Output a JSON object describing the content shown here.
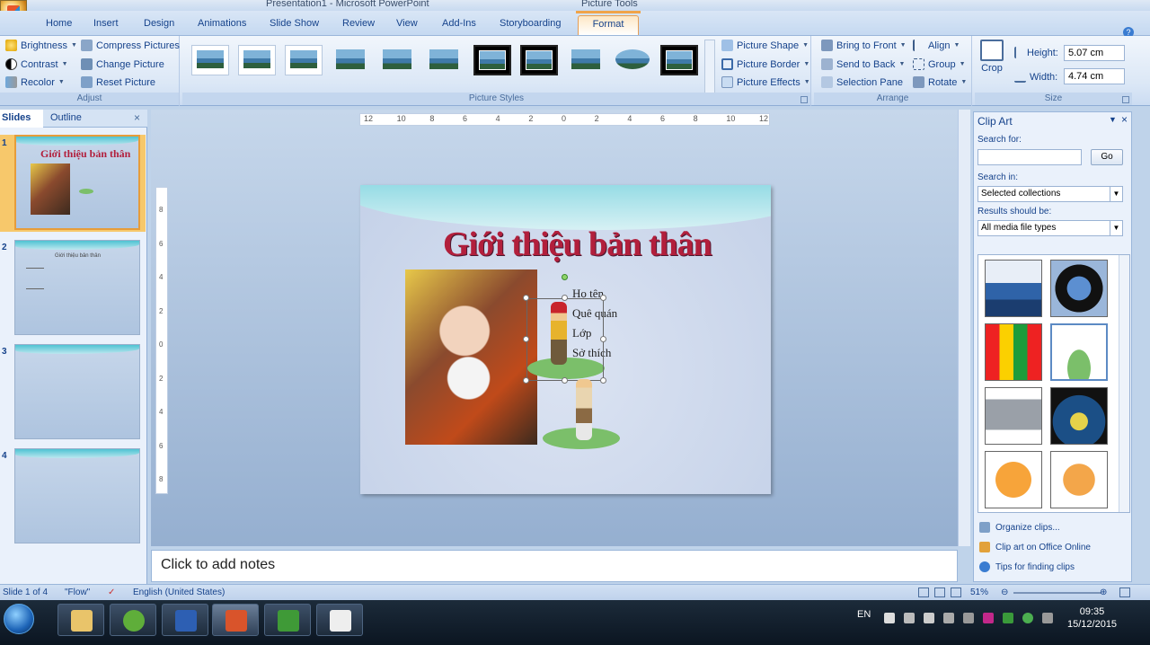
{
  "window": {
    "title": "Presentation1 - Microsoft PowerPoint",
    "context_tab_group": "Picture Tools"
  },
  "tabs": [
    "Home",
    "Insert",
    "Design",
    "Animations",
    "Slide Show",
    "Review",
    "View",
    "Add-Ins",
    "Storyboarding",
    "Format"
  ],
  "active_tab": "Format",
  "ribbon": {
    "adjust": {
      "label": "Adjust",
      "brightness": "Brightness",
      "contrast": "Contrast",
      "recolor": "Recolor",
      "compress": "Compress Pictures",
      "change": "Change Picture",
      "reset": "Reset Picture"
    },
    "styles": {
      "label": "Picture Styles",
      "shape": "Picture Shape",
      "border": "Picture Border",
      "effects": "Picture Effects"
    },
    "arrange": {
      "label": "Arrange",
      "bring_front": "Bring to Front",
      "send_back": "Send to Back",
      "selection_pane": "Selection Pane",
      "align": "Align",
      "group": "Group",
      "rotate": "Rotate"
    },
    "size": {
      "label": "Size",
      "crop": "Crop",
      "height_label": "Height:",
      "height_value": "5.07 cm",
      "width_label": "Width:",
      "width_value": "4.74 cm"
    }
  },
  "left_panel": {
    "tab_slides": "Slides",
    "tab_outline": "Outline",
    "close": "×",
    "slides": [
      {
        "num": "1",
        "title": "Giới thiệu bản thân"
      },
      {
        "num": "2",
        "title": "Giới thiệu bản thân"
      },
      {
        "num": "3"
      },
      {
        "num": "4"
      }
    ]
  },
  "ruler": {
    "h_ticks": [
      "12",
      "10",
      "8",
      "6",
      "4",
      "2",
      "0",
      "2",
      "4",
      "6",
      "8",
      "10",
      "12"
    ],
    "v_ticks": [
      "8",
      "6",
      "4",
      "2",
      "0",
      "2",
      "4",
      "6",
      "8"
    ]
  },
  "slide": {
    "title": "Giới thiệu bản thân",
    "bullets": [
      "Họ tên",
      "Quê quán",
      "Lớp",
      "Sở thích"
    ]
  },
  "notes": {
    "placeholder": "Click to add notes"
  },
  "clip_art": {
    "title": "Clip Art",
    "search_for": "Search for:",
    "go": "Go",
    "search_in": "Search in:",
    "search_in_value": "Selected collections",
    "results_label": "Results should be:",
    "results_value": "All media file types",
    "links": [
      "Organize clips...",
      "Clip art on Office Online",
      "Tips for finding clips"
    ]
  },
  "status": {
    "slide": "Slide 1 of 4",
    "theme": "\"Flow\"",
    "language": "English (United States)",
    "zoom": "51%"
  },
  "taskbar": {
    "language": "EN",
    "time": "09:35",
    "date": "15/12/2015"
  },
  "colors": {
    "ribbon_bg": "#dbe7f6",
    "format_tab": "#f0a44a",
    "title_red": "#b21f3c",
    "selection_orange": "#e69c3a"
  }
}
